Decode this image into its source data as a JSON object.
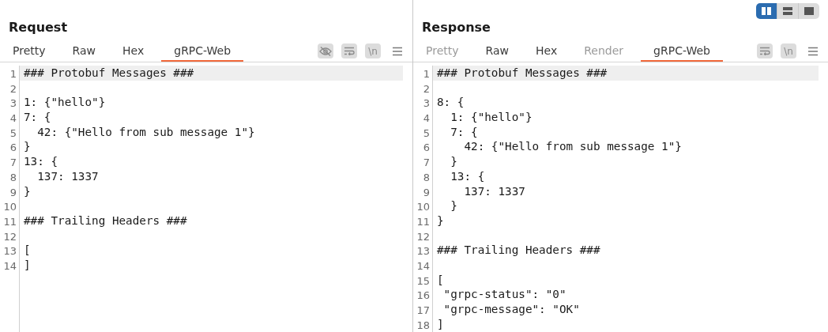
{
  "layout_toggle": [
    {
      "kind": "columns",
      "selected": true
    },
    {
      "kind": "rows",
      "selected": false
    },
    {
      "kind": "single",
      "selected": false
    }
  ],
  "panes": [
    {
      "title": "Request",
      "tabs": [
        {
          "label": "Pretty",
          "selected": false,
          "disabled": false
        },
        {
          "label": "Raw",
          "selected": false,
          "disabled": false
        },
        {
          "label": "Hex",
          "selected": false,
          "disabled": false
        },
        {
          "label": "gRPC-Web",
          "selected": true,
          "disabled": false
        }
      ],
      "tools": [
        {
          "kind": "eye-off"
        },
        {
          "kind": "wrap"
        },
        {
          "kind": "text",
          "label": "\\n"
        },
        {
          "kind": "menu"
        }
      ],
      "lines": [
        {
          "number": "1",
          "text": "### Protobuf Messages ###",
          "highlighted": true
        },
        {
          "number": "2",
          "highlighted": false
        },
        {
          "number": "3",
          "text": "1: {\"hello\"}",
          "highlighted": false
        },
        {
          "number": "4",
          "text": "7: {",
          "highlighted": false
        },
        {
          "number": "5",
          "text": "  42: {\"Hello from sub message 1\"}",
          "highlighted": false
        },
        {
          "number": "6",
          "text": "}",
          "highlighted": false
        },
        {
          "number": "7",
          "text": "13: {",
          "highlighted": false
        },
        {
          "number": "8",
          "text": "  137: 1337",
          "highlighted": false
        },
        {
          "number": "9",
          "text": "}",
          "highlighted": false
        },
        {
          "number": "10",
          "highlighted": false
        },
        {
          "number": "11",
          "text": "### Trailing Headers ###",
          "highlighted": false
        },
        {
          "number": "12",
          "highlighted": false
        },
        {
          "number": "13",
          "text": "[",
          "highlighted": false
        },
        {
          "number": "14",
          "text": "]",
          "highlighted": false
        }
      ]
    },
    {
      "title": "Response",
      "tabs": [
        {
          "label": "Pretty",
          "selected": false,
          "disabled": true
        },
        {
          "label": "Raw",
          "selected": false,
          "disabled": false
        },
        {
          "label": "Hex",
          "selected": false,
          "disabled": false
        },
        {
          "label": "Render",
          "selected": false,
          "disabled": true
        },
        {
          "label": "gRPC-Web",
          "selected": true,
          "disabled": false
        }
      ],
      "tools": [
        {
          "kind": "wrap"
        },
        {
          "kind": "text",
          "label": "\\n"
        },
        {
          "kind": "menu"
        }
      ],
      "lines": [
        {
          "number": "1",
          "text": "### Protobuf Messages ###",
          "highlighted": true
        },
        {
          "number": "2",
          "highlighted": false
        },
        {
          "number": "3",
          "text": "8: {",
          "highlighted": false
        },
        {
          "number": "4",
          "text": "  1: {\"hello\"}",
          "highlighted": false
        },
        {
          "number": "5",
          "text": "  7: {",
          "highlighted": false
        },
        {
          "number": "6",
          "text": "    42: {\"Hello from sub message 1\"}",
          "highlighted": false
        },
        {
          "number": "7",
          "text": "  }",
          "highlighted": false
        },
        {
          "number": "8",
          "text": "  13: {",
          "highlighted": false
        },
        {
          "number": "9",
          "text": "    137: 1337",
          "highlighted": false
        },
        {
          "number": "10",
          "text": "  }",
          "highlighted": false
        },
        {
          "number": "11",
          "text": "}",
          "highlighted": false
        },
        {
          "number": "12",
          "highlighted": false
        },
        {
          "number": "13",
          "text": "### Trailing Headers ###",
          "highlighted": false
        },
        {
          "number": "14",
          "highlighted": false
        },
        {
          "number": "15",
          "text": "[",
          "highlighted": false
        },
        {
          "number": "16",
          "text": " \"grpc-status\": \"0\"",
          "highlighted": false
        },
        {
          "number": "17",
          "text": " \"grpc-message\": \"OK\"",
          "highlighted": false
        },
        {
          "number": "18",
          "text": "]",
          "highlighted": false
        }
      ]
    }
  ]
}
